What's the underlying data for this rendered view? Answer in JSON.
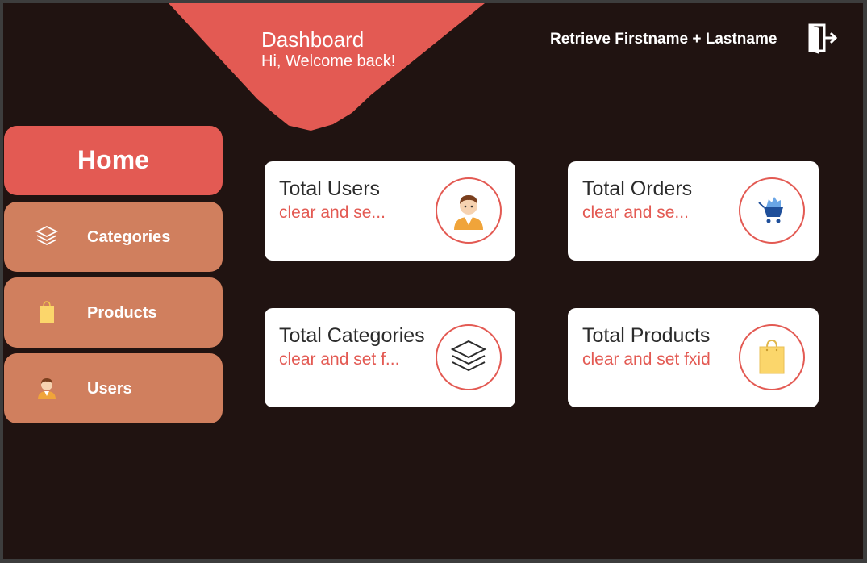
{
  "header": {
    "title": "Dashboard",
    "subtitle": "Hi, Welcome back!",
    "user_name": "Retrieve Firstname + Lastname",
    "logout_icon": "logout-icon"
  },
  "nav": {
    "home": "Home",
    "categories": "Categories",
    "products": "Products",
    "users": "Users"
  },
  "cards": [
    {
      "title": "Total Users",
      "value": "clear and se...",
      "icon": "user-avatar-icon"
    },
    {
      "title": "Total Orders",
      "value": "clear and se...",
      "icon": "shopping-cart-icon"
    },
    {
      "title": "Total Categories",
      "value": "clear and set f...",
      "icon": "layers-icon"
    },
    {
      "title": "Total Products",
      "value": "clear and set fxid",
      "icon": "shopping-bag-icon"
    }
  ],
  "colors": {
    "background": "#201311",
    "accent": "#e35a53",
    "nav_item": "#d07f5e",
    "card": "#ffffff"
  }
}
